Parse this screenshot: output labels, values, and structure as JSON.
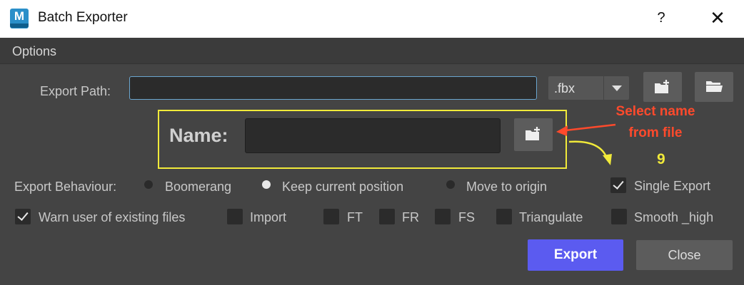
{
  "window": {
    "title": "Batch Exporter",
    "icon": "M",
    "help": "?",
    "close": "✕"
  },
  "menu": {
    "options": "Options"
  },
  "export_path": {
    "label": "Export Path:",
    "value": "",
    "format": ".fbx"
  },
  "name": {
    "label": "Name:",
    "value": ""
  },
  "annotation": {
    "line1": "Select name",
    "line2": "from file",
    "number": "9",
    "arrow_color": "#ff4a2c",
    "highlight_color": "#f1ea3a"
  },
  "behaviour": {
    "label": "Export Behaviour:",
    "options": [
      "Boomerang",
      "Keep current position",
      "Move to origin"
    ],
    "selected": "Keep current position"
  },
  "checkboxes": {
    "single_export": "Single Export",
    "warn": "Warn user of existing files",
    "import": "Import",
    "ft": "FT",
    "fr": "FR",
    "fs": "FS",
    "triangulate": "Triangulate",
    "smooth": "Smooth _high"
  },
  "buttons": {
    "export": "Export",
    "close": "Close"
  },
  "colors": {
    "accent": "#5b5bf0",
    "background": "#444444"
  }
}
